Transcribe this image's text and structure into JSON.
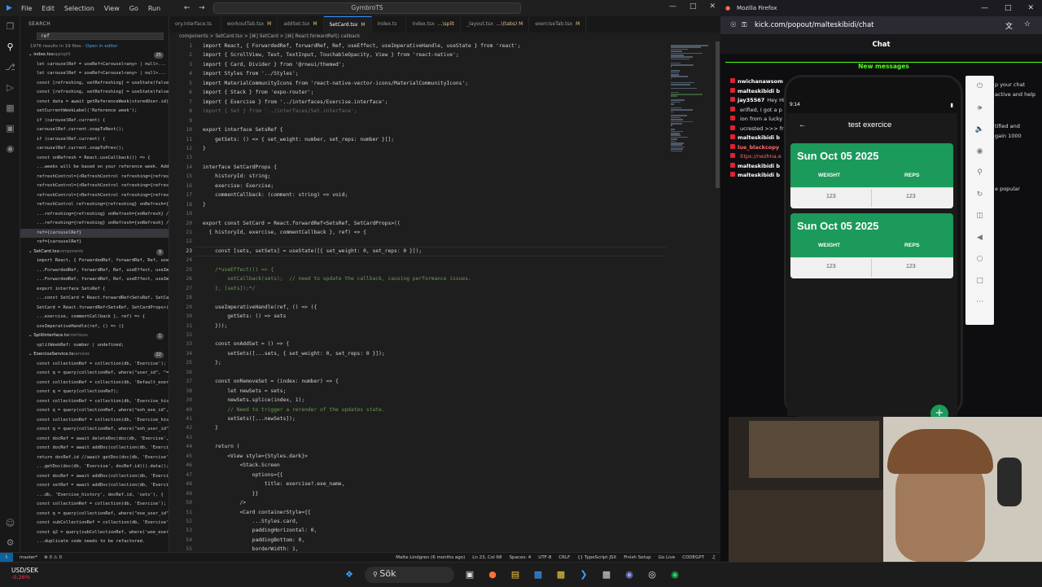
{
  "vscode": {
    "menu": [
      "File",
      "Edit",
      "Selection",
      "View",
      "Go",
      "Run"
    ],
    "command_center": "GymbroTS",
    "sidebar": {
      "title": "SEARCH",
      "query": "ref",
      "summary": "1976 results in 19 files - ",
      "open_in_editor": "Open in editor",
      "rows": [
        {
          "kind": "file",
          "text": "index.tsx",
          "tag": "app\\split",
          "count": "25"
        },
        {
          "kind": "match",
          "text": "let carouselRef = useRef<Carousel<any> | null>..."
        },
        {
          "kind": "match",
          "text": "let carouselRef = useRef<Carousel<any> | null>..."
        },
        {
          "kind": "match",
          "text": "const [refreshing, setRefreshing] = useState(false);"
        },
        {
          "kind": "match",
          "text": "const [refreshing, setRefreshing] = useState(false);"
        },
        {
          "kind": "match",
          "text": "const data = await getReferenceWeek(storedUser.id)..."
        },
        {
          "kind": "match",
          "text": "setCurrentWeekLabel('Reference week');"
        },
        {
          "kind": "match",
          "text": "if (carouselRef.current) {"
        },
        {
          "kind": "match",
          "text": "carouselRef.current.snapToNext();"
        },
        {
          "kind": "match",
          "text": "if (carouselRef.current) {"
        },
        {
          "kind": "match",
          "text": "carouselRef.current.snapToPrev();"
        },
        {
          "kind": "match",
          "text": "const onRefresh = React.useCallback(() => {"
        },
        {
          "kind": "match",
          "text": "...weeks will be based on your reference week. Add th..."
        },
        {
          "kind": "match",
          "text": "refreshControl={<RefreshControl refreshing={refreshi..."
        },
        {
          "kind": "match",
          "text": "refreshControl={<RefreshControl refreshing={refreshi..."
        },
        {
          "kind": "match",
          "text": "refreshControl={<RefreshControl refreshing={refreshi..."
        },
        {
          "kind": "match",
          "text": "refreshControl refreshing={refreshing} onRefresh={r..."
        },
        {
          "kind": "match",
          "text": "...refreshing={refreshing} onRefresh={onRefresh} />}"
        },
        {
          "kind": "match",
          "text": "...refreshing={refreshing} onRefresh={onRefresh} />}"
        },
        {
          "kind": "match",
          "text": "ref={carouselRef}",
          "sel": true
        },
        {
          "kind": "match",
          "text": "ref={carouselRef}"
        },
        {
          "kind": "file",
          "text": "SetCard.tsx",
          "tag": "components",
          "count": "9"
        },
        {
          "kind": "match",
          "text": "import React, { ForwardedRef, forwardRef, Ref, useEff..."
        },
        {
          "kind": "match",
          "text": "...ForwardedRef, forwardRef, Ref, useEffect, useImpera..."
        },
        {
          "kind": "match",
          "text": "...ForwardedRef, forwardRef, Ref, useEffect, useImpera..."
        },
        {
          "kind": "match",
          "text": "export interface SetsRef {"
        },
        {
          "kind": "match",
          "text": "...const SetCard = React.forwardRef<SetsRef, SetCardProps..."
        },
        {
          "kind": "match",
          "text": "SetCard = React.forwardRef<SetsRef, SetCardProps>(("
        },
        {
          "kind": "match",
          "text": "...exercise, commentCallback }, ref) => {"
        },
        {
          "kind": "match",
          "text": "useImperativeHandle(ref, () => ({"
        },
        {
          "kind": "file",
          "text": "SplitInterface.ts",
          "tag": "interfaces",
          "count": "1"
        },
        {
          "kind": "match",
          "text": "splitWeekRef: number | undefined;"
        },
        {
          "kind": "file",
          "text": "ExerciseService.ts",
          "tag": "services",
          "count": "22"
        },
        {
          "kind": "match",
          "text": "const collectionRef = collection(db, 'Exercise');"
        },
        {
          "kind": "match",
          "text": "const q = query(collectionRef, where(\"user_id\", \"=..."
        },
        {
          "kind": "match",
          "text": "const collectionRef = collection(db, 'Default_exercises');"
        },
        {
          "kind": "match",
          "text": "const q = query(collectionRef);"
        },
        {
          "kind": "match",
          "text": "const collectionRef = collection(db, 'Exercise_history');"
        },
        {
          "kind": "match",
          "text": "const q = query(collectionRef, where(\"exh_exe_id\", \"=..."
        },
        {
          "kind": "match",
          "text": "const collectionRef = collection(db, 'Exercise_history');"
        },
        {
          "kind": "match",
          "text": "const q = query(collectionRef, where(\"exh_user_id\", \"=..."
        },
        {
          "kind": "match",
          "text": "const docRef = await deleteDoc(doc(db, 'Exercise', e..."
        },
        {
          "kind": "match",
          "text": "const docRef = await addDoc(collection(db, 'Exercise..."
        },
        {
          "kind": "match",
          "text": "return docRef.id //await getDoc(doc(db, 'Exercise', d..."
        },
        {
          "kind": "match",
          "text": "...getDoc(doc(db, 'Exercise', docRef.id))).data(); TODO..."
        },
        {
          "kind": "match",
          "text": "const docRef = await addDoc(collection(db, 'Exercise..."
        },
        {
          "kind": "match",
          "text": "const setRef = await addDoc(collection(db, 'Exercise..."
        },
        {
          "kind": "match",
          "text": "...db, 'Exercise_history', docRef.id, 'sets'), {"
        },
        {
          "kind": "match",
          "text": "const collectionRef = collection(db, 'Exercise');"
        },
        {
          "kind": "match",
          "text": "const q = query(collectionRef, where(\"exe_user_id\", \"=..."
        },
        {
          "kind": "match",
          "text": "const subCollectionRef = collection(db, 'Exercise', wo..."
        },
        {
          "kind": "match",
          "text": "const q2 = query(subCollectionRef, where('woe_exerc..."
        },
        {
          "kind": "match",
          "text": "...duplicate code needs to be refactored."
        }
      ]
    },
    "tabs": [
      {
        "label": "ory.interface.ts",
        "mod": ""
      },
      {
        "label": "workoutTab.tsx",
        "mod": "M"
      },
      {
        "label": "addSet.tsx",
        "mod": "M"
      },
      {
        "label": "SetCard.tsx",
        "mod": "M",
        "active": true
      },
      {
        "label": "index.ts",
        "mod": ""
      },
      {
        "label": "index.tsx",
        "mod": "...\\split"
      },
      {
        "label": "_layout.tsx",
        "mod": "...\\(tabs) M"
      },
      {
        "label": "exerciseTab.tsx",
        "mod": "M"
      }
    ],
    "breadcrumb": "components > SetCard.tsx > [⌘] SetCard > [⌘] React.forwardRef() callback",
    "code_lines": [
      {
        "n": "1",
        "t": "import React, { ForwardedRef, forwardRef, Ref, useEffect, useImperativeHandle, useState } from 'react';"
      },
      {
        "n": "2",
        "t": "import { ScrollView, Text, TextInput, TouchableOpacity, View } from 'react-native';"
      },
      {
        "n": "3",
        "t": "import { Card, Divider } from '@rneui/themed';"
      },
      {
        "n": "4",
        "t": "import Styles from '../Styles';"
      },
      {
        "n": "5",
        "t": "import MaterialCommunityIcons from 'react-native-vector-icons/MaterialCommunityIcons';"
      },
      {
        "n": "6",
        "t": "import { Stack } from 'expo-router';"
      },
      {
        "n": "7",
        "t": "import { Exercise } from '../interfaces/Exercise.interface';"
      },
      {
        "n": "8",
        "t": "import { Set } from '../interfaces/Set.interface';",
        "dim": true
      },
      {
        "n": "9",
        "t": ""
      },
      {
        "n": "10",
        "t": "export interface SetsRef {"
      },
      {
        "n": "11",
        "t": "    getSets: () => { set_weight: number, set_reps: number }[];"
      },
      {
        "n": "12",
        "t": "}"
      },
      {
        "n": "13",
        "t": ""
      },
      {
        "n": "14",
        "t": "interface SetCardProps {"
      },
      {
        "n": "15",
        "t": "    historyId: string;"
      },
      {
        "n": "16",
        "t": "    exercise: Exercise;"
      },
      {
        "n": "17",
        "t": "    commentCallback: (comment: string) => void;"
      },
      {
        "n": "18",
        "t": "}"
      },
      {
        "n": "19",
        "t": ""
      },
      {
        "n": "20",
        "t": "export const SetCard = React.forwardRef<SetsRef, SetCardProps>(("
      },
      {
        "n": "21",
        "t": "  { historyId, exercise, commentCallback }, ref) => {"
      },
      {
        "n": "22",
        "t": ""
      },
      {
        "n": "23",
        "t": "    const [sets, setSets] = useState([{ set_weight: 0, set_reps: 0 }]);",
        "cur": true
      },
      {
        "n": "24",
        "t": ""
      },
      {
        "n": "25",
        "t": "    /*useEffect(() => {",
        "c": true
      },
      {
        "n": "26",
        "t": "        setCallback(sets);  // need to update the callback, causing performance issues.",
        "c": true
      },
      {
        "n": "27",
        "t": "    }, [sets]);*/",
        "c": true
      },
      {
        "n": "28",
        "t": ""
      },
      {
        "n": "29",
        "t": "    useImperativeHandle(ref, () => ({"
      },
      {
        "n": "30",
        "t": "        getSets: () => sets"
      },
      {
        "n": "31",
        "t": "    }));"
      },
      {
        "n": "32",
        "t": ""
      },
      {
        "n": "33",
        "t": "    const onAddSet = () => {"
      },
      {
        "n": "34",
        "t": "        setSets([...sets, { set_weight: 0, set_reps: 0 }]);"
      },
      {
        "n": "35",
        "t": "    };"
      },
      {
        "n": "36",
        "t": ""
      },
      {
        "n": "37",
        "t": "    const onRemoveSet = (index: number) => {"
      },
      {
        "n": "38",
        "t": "        let newSets = sets;"
      },
      {
        "n": "39",
        "t": "        newSets.splice(index, 1);"
      },
      {
        "n": "40",
        "t": "        // Need to trigger a rerender of the updates state.",
        "c": true
      },
      {
        "n": "41",
        "t": "        setSets([...newSets]);"
      },
      {
        "n": "42",
        "t": "    }"
      },
      {
        "n": "43",
        "t": ""
      },
      {
        "n": "44",
        "t": "    return ("
      },
      {
        "n": "45",
        "t": "        <View style={Styles.dark}>"
      },
      {
        "n": "46",
        "t": "            <Stack.Screen"
      },
      {
        "n": "47",
        "t": "                options={{"
      },
      {
        "n": "48",
        "t": "                    title: exercise?.exe_name,"
      },
      {
        "n": "49",
        "t": "                }}"
      },
      {
        "n": "50",
        "t": "            />"
      },
      {
        "n": "51",
        "t": "            <Card containerStyle={{"
      },
      {
        "n": "52",
        "t": "                ...Styles.card,"
      },
      {
        "n": "53",
        "t": "                paddingHorizontal: 0,"
      },
      {
        "n": "54",
        "t": "                paddingBottom: 0,"
      },
      {
        "n": "55",
        "t": "                borderWidth: 1,"
      }
    ],
    "status": {
      "branch": "master*",
      "errors": "⊗ 0 ⚠ 0",
      "blame": "Malte Lindgren (6 months ago)",
      "position": "Ln 23, Col 68",
      "spaces": "Spaces: 4",
      "encoding": "UTF-8",
      "eol": "CRLF",
      "language": "{} TypeScript JSX",
      "finish": "Finish Setup",
      "golive": "Go Live",
      "codegpt": "CODEGPT"
    }
  },
  "firefox": {
    "title": "Mozilla Firefox",
    "url": "kick.com/popout/malteskibidi/chat",
    "chat_title": "Chat",
    "new_messages": "New messages",
    "chat_lines": [
      {
        "user": "nwichanawsom",
        "text": ""
      },
      {
        "user": "malteskibidi b",
        "text": ""
      },
      {
        "user": "jay35567",
        "text": "Hey Hi"
      },
      {
        "user": "",
        "text": "erified, I got a p"
      },
      {
        "user": "",
        "text": "ion from a lucky"
      },
      {
        "user": "",
        "text": "ucrested >>> fr"
      },
      {
        "user": "malteskibidi b",
        "text": ""
      },
      {
        "user": "lue_blackcopy",
        "text": ""
      },
      {
        "user": "",
        "text": "ittps://nezhna.e"
      },
      {
        "user": "malteskibidi b",
        "text": ""
      },
      {
        "user": "malteskibidi b",
        "text": ""
      }
    ],
    "right_bits": [
      "p your chat",
      "active and help",
      "tified and",
      "gain 1000",
      "e popular"
    ]
  },
  "emulator": {
    "time": "9:14",
    "screen_title": "test exercice",
    "cards": [
      {
        "date": "Sun Oct 05 2025",
        "weight_label": "WEIGHT",
        "reps_label": "REPS",
        "weight": "123",
        "reps": "123"
      },
      {
        "date": "Sun Oct 05 2025",
        "weight_label": "WEIGHT",
        "reps_label": "REPS",
        "weight": "123",
        "reps": "123"
      }
    ],
    "fab": "+"
  },
  "taskbar": {
    "ticker": "USD/SEK",
    "change": "-0,26%",
    "search_label": "Sök"
  },
  "colors": {
    "accent": "#3794ff",
    "kick_green": "#53fc18",
    "card_green": "#1b9a5b"
  }
}
